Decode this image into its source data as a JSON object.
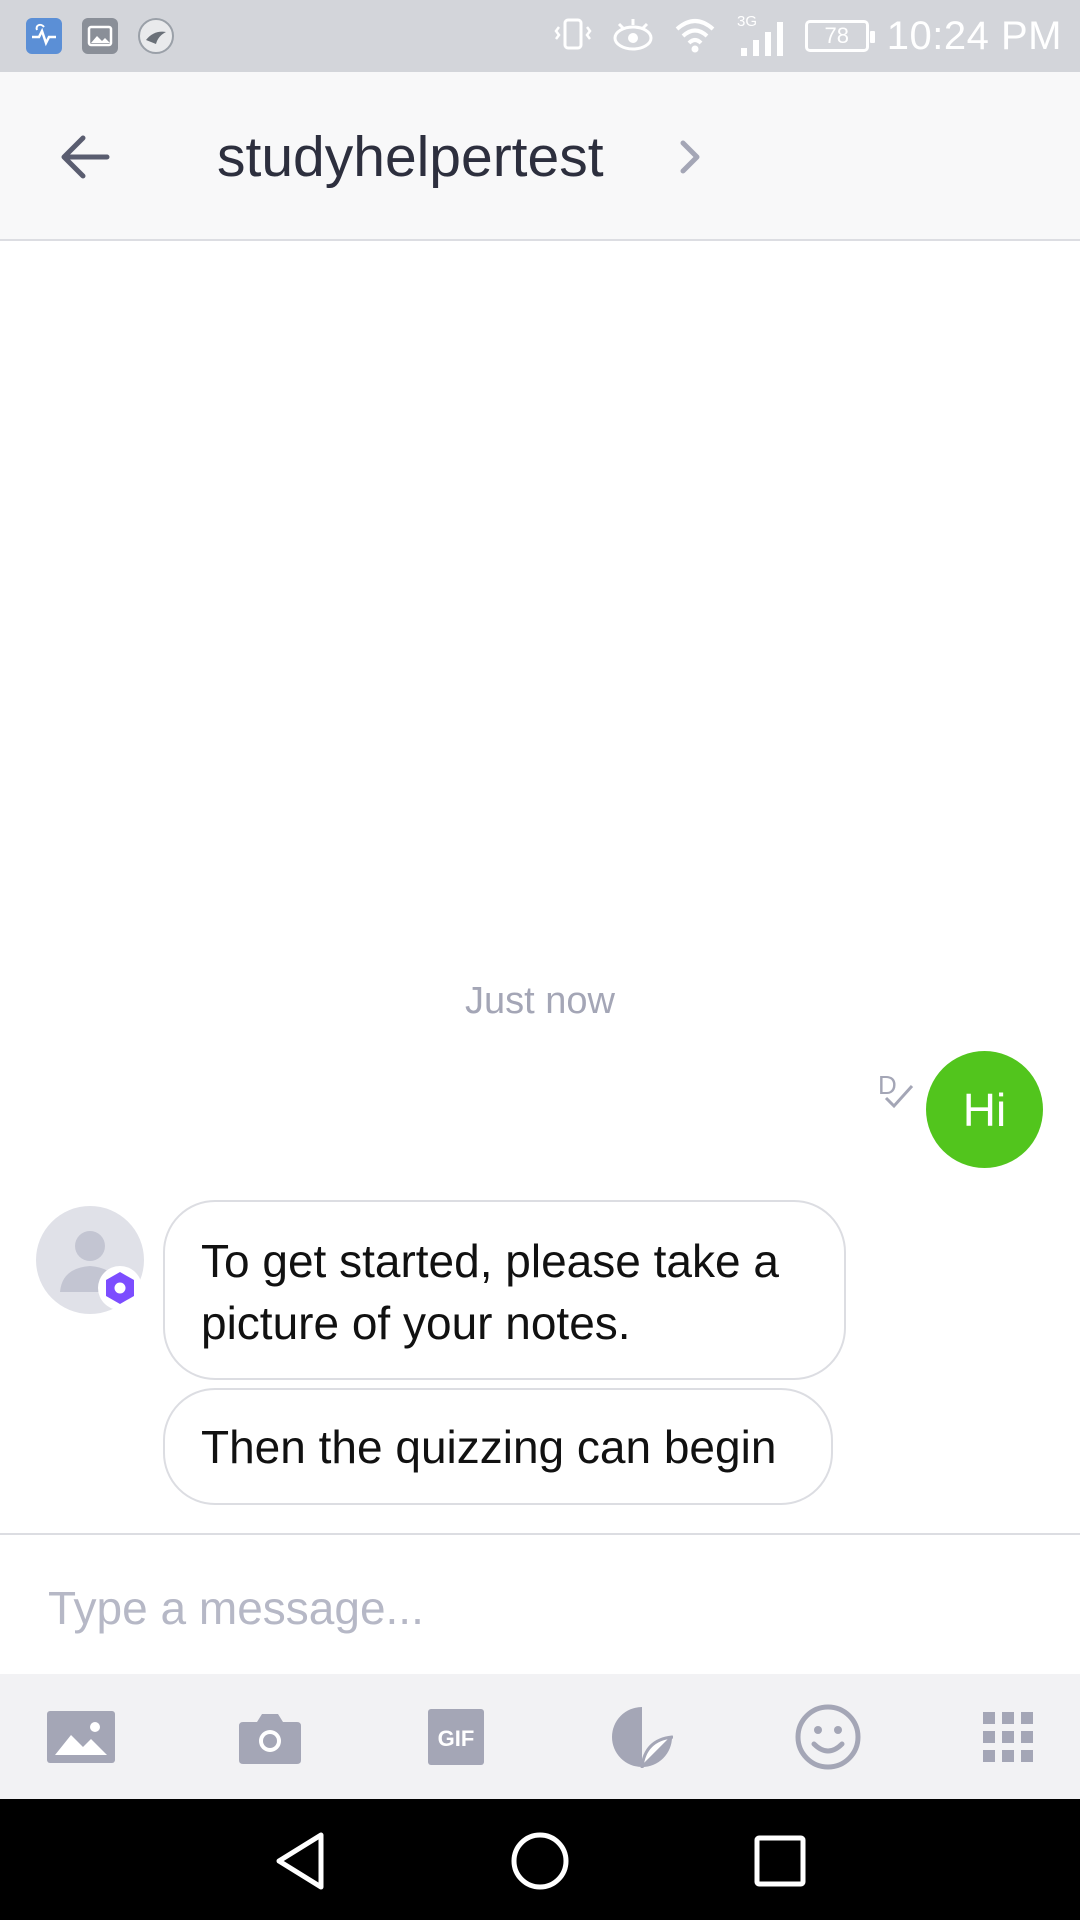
{
  "status_bar": {
    "notifications": [
      "heart-monitor-icon",
      "gallery-icon",
      "bird-icon"
    ],
    "network": "3G",
    "battery": "78",
    "time": "10:24 PM"
  },
  "header": {
    "title": "studyhelpertest"
  },
  "conversation": {
    "timestamp": "Just now",
    "read_indicator": "D",
    "sent_message": "Hi",
    "received_messages": [
      "To get started, please take a picture of your notes.",
      "Then the quizzing can begin"
    ]
  },
  "composer": {
    "placeholder": "Type a message...",
    "tools": [
      "image-icon",
      "camera-icon",
      "gif-icon",
      "sticker-icon",
      "emoji-icon",
      "apps-grid-icon"
    ],
    "gif_label": "GIF"
  },
  "colors": {
    "sent_bubble": "#52c51d",
    "header_text": "#2d2f3e",
    "accent_badge": "#7c4dff",
    "icon_gray": "#a4a6b6"
  }
}
